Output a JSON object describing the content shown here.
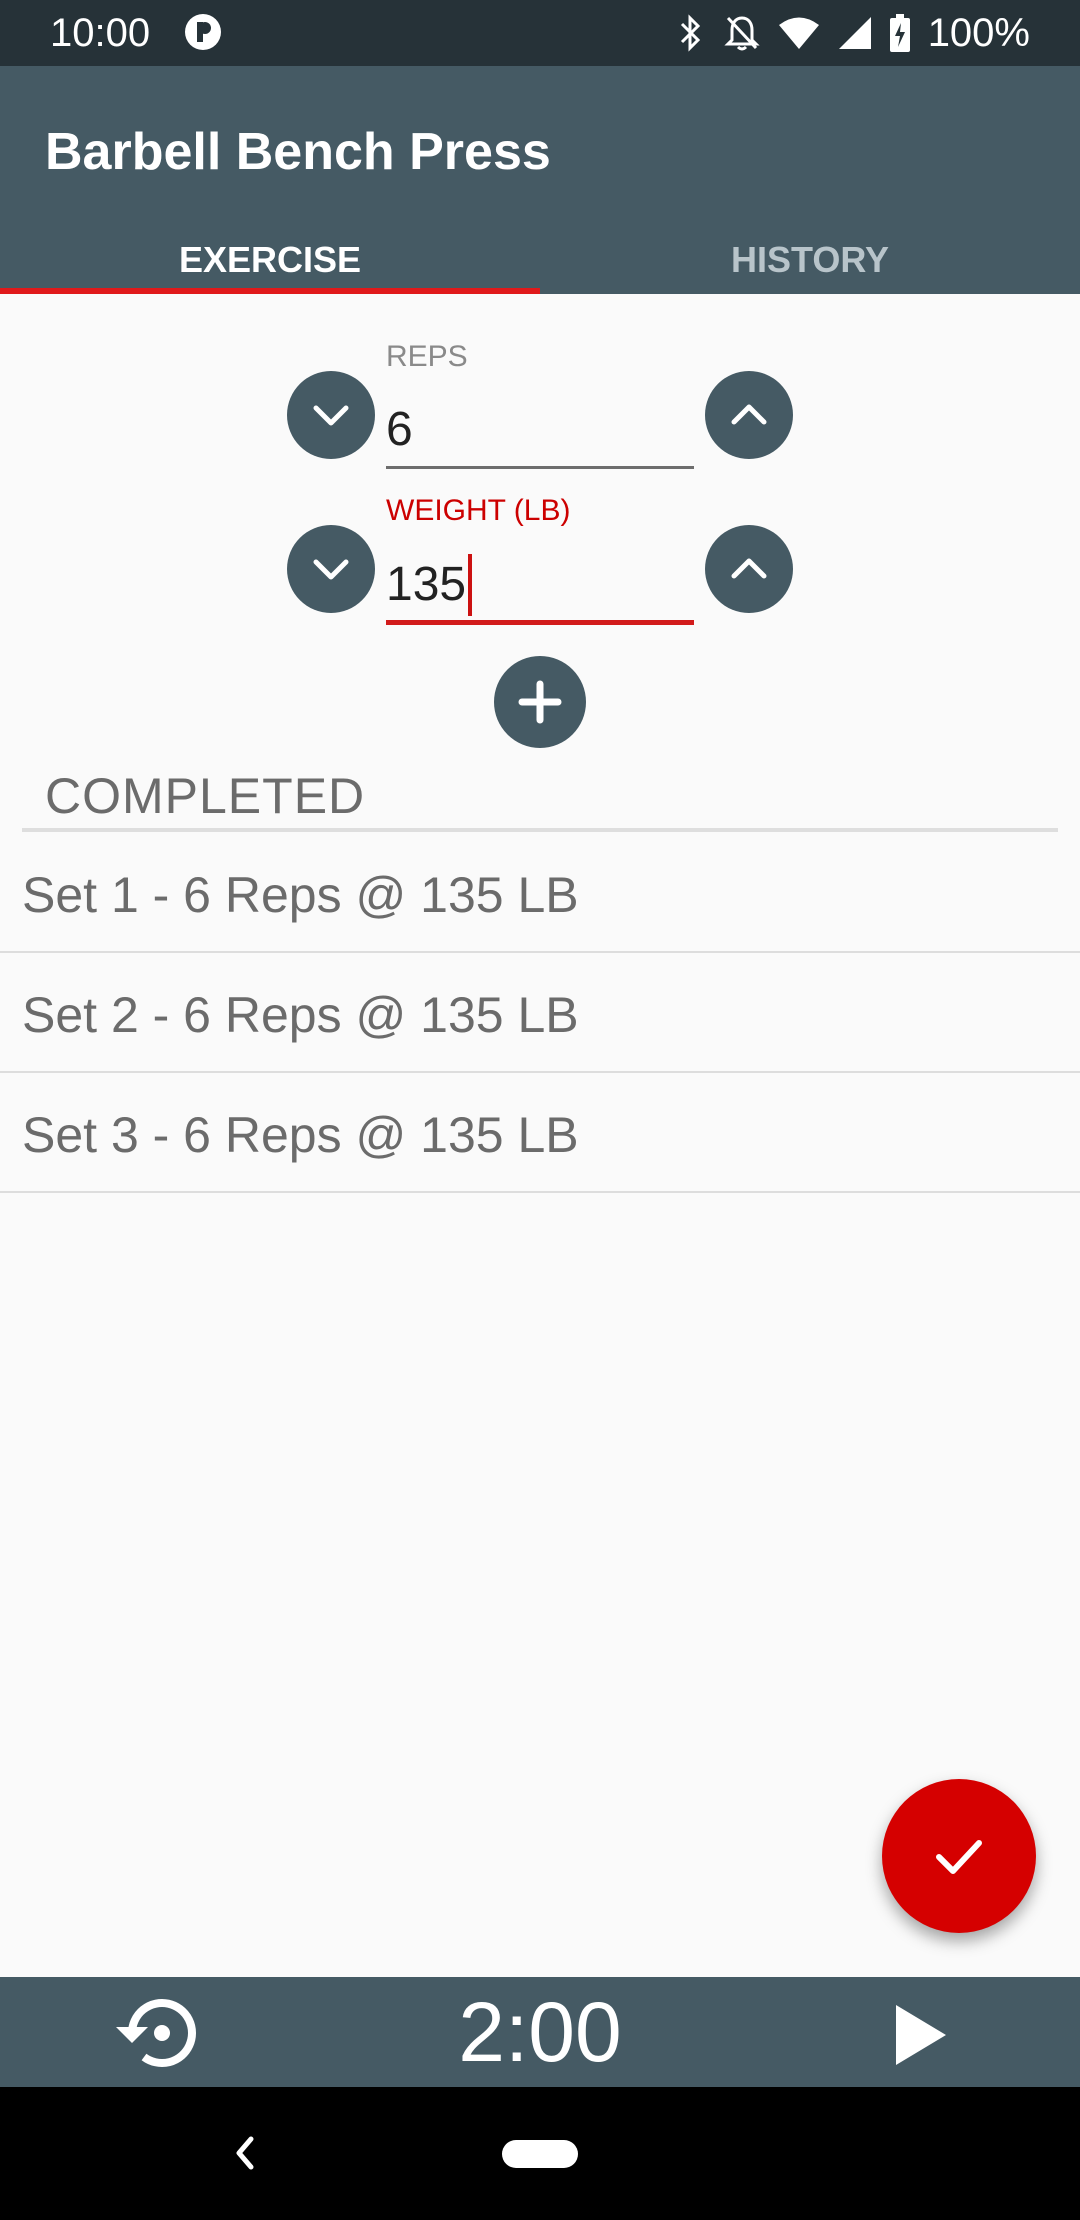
{
  "status_bar": {
    "time": "10:00",
    "battery": "100%",
    "icons": [
      "app-notification-icon",
      "bluetooth-icon",
      "notifications-off-icon",
      "wifi-icon",
      "cell-signal-icon",
      "battery-charging-icon"
    ]
  },
  "app_bar": {
    "title": "Barbell Bench Press",
    "tabs": [
      {
        "label": "EXERCISE",
        "selected": true
      },
      {
        "label": "HISTORY",
        "selected": false
      }
    ]
  },
  "exercise": {
    "reps": {
      "label": "REPS",
      "value": "6"
    },
    "weight": {
      "label": "WEIGHT (LB)",
      "value": "135"
    }
  },
  "completed": {
    "header": "COMPLETED",
    "sets": [
      {
        "text": "Set 1 - 6 Reps @ 135 LB"
      },
      {
        "text": "Set 2 - 6 Reps @ 135 LB"
      },
      {
        "text": "Set 3 - 6 Reps @ 135 LB"
      }
    ]
  },
  "timer": {
    "display": "2:00"
  },
  "colors": {
    "status_bar": "#263238",
    "primary": "#455a64",
    "accent": "#d50000",
    "background": "#fafafa"
  }
}
